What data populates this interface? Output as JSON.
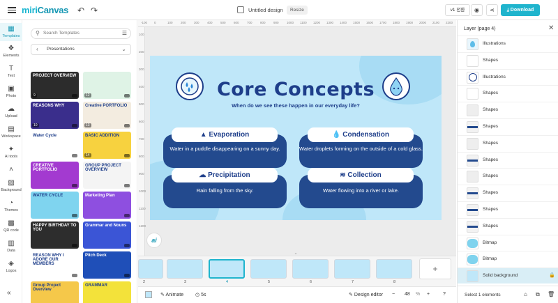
{
  "app": {
    "logo_a": "miri",
    "logo_b": "Canvas",
    "doc_title": "Untitled design",
    "resize": "Resize",
    "version": "v1 전환",
    "download": "Download"
  },
  "rail": [
    {
      "label": "Templates",
      "icon": "templates-icon"
    },
    {
      "label": "Elements",
      "icon": "elements-icon"
    },
    {
      "label": "Text",
      "icon": "text-icon"
    },
    {
      "label": "Photo",
      "icon": "photo-icon"
    },
    {
      "label": "Upload",
      "icon": "upload-icon"
    },
    {
      "label": "Workspace",
      "icon": "workspace-icon"
    },
    {
      "label": "AI tools",
      "icon": "ai-tools-icon"
    },
    {
      "label": "Background",
      "icon": "background-icon"
    },
    {
      "label": "Themes",
      "icon": "themes-icon"
    },
    {
      "label": "QR code",
      "icon": "qr-code-icon"
    },
    {
      "label": "Data",
      "icon": "data-icon"
    },
    {
      "label": "Logos",
      "icon": "logos-icon"
    }
  ],
  "templates": {
    "search_placeholder": "Search Templates",
    "category": "Presentations",
    "items": [
      {
        "title": "PROJECT OVERVIEW",
        "num": "9",
        "bg": "#2c2c2c"
      },
      {
        "title": "",
        "num": "12",
        "bg": "#dff3e6"
      },
      {
        "title": "REASONS WHY",
        "num": "10",
        "bg": "#3a2e8c"
      },
      {
        "title": "Creative PORTFOLIO",
        "num": "13",
        "bg": "#f3ece0"
      },
      {
        "title": "Water Cycle",
        "num": "",
        "bg": "#ffffff"
      },
      {
        "title": "BASIC ADDITION",
        "num": "14",
        "bg": "#f7d23f"
      },
      {
        "title": "CREATIVE PORTFOLIO",
        "num": "",
        "bg": "#a33ad0"
      },
      {
        "title": "GROUP PROJECT OVERVIEW",
        "num": "",
        "bg": "#f4f4f4"
      },
      {
        "title": "WATER CYCLE",
        "num": "",
        "bg": "#7fd4ef"
      },
      {
        "title": "Marketing Plan",
        "num": "",
        "bg": "#8e4fe0"
      },
      {
        "title": "HAPPY BIRTHDAY TO YOU",
        "num": "",
        "bg": "#2d2d2d"
      },
      {
        "title": "Grammar and Nouns",
        "num": "",
        "bg": "#3b55d6"
      },
      {
        "title": "REASON WHY I ADORE OUR MEMBERS",
        "num": "",
        "bg": "#ffffff"
      },
      {
        "title": "Pitch Deck",
        "num": "",
        "bg": "#1f4fb8"
      },
      {
        "title": "Group Project Overview",
        "num": "",
        "bg": "#f5c84a"
      },
      {
        "title": "GRAMMAR",
        "num": "",
        "bg": "#f3e23a"
      }
    ]
  },
  "slide": {
    "title": "Core Concepts",
    "subtitle": "When do we see these happen in our everyday life?",
    "cards": [
      {
        "head": "Evaporation",
        "body": "Water in a puddle disappearing on a sunny day."
      },
      {
        "head": "Condensation",
        "body": "Water droplets forming on the outside of a cold glass."
      },
      {
        "head": "Precipitation",
        "body": "Rain falling from the sky."
      },
      {
        "head": "Collection",
        "body": "Water flowing into a river or lake."
      }
    ]
  },
  "ruler_top": [
    "-100",
    "0",
    "100",
    "200",
    "300",
    "400",
    "500",
    "600",
    "700",
    "800",
    "900",
    "1000",
    "1100",
    "1200",
    "1300",
    "1400",
    "1500",
    "1600",
    "1700",
    "1800",
    "1900",
    "2000",
    "2100",
    "2200"
  ],
  "ruler_left": [
    "100",
    "200",
    "300",
    "400",
    "500",
    "600",
    "700",
    "800",
    "900",
    "1000",
    "1100",
    "1200"
  ],
  "pages": [
    "2",
    "3",
    "4",
    "5",
    "6",
    "7",
    "8"
  ],
  "bottom": {
    "animate": "Animate",
    "duration": "5s",
    "design_editor": "Design editor",
    "zoom": "48",
    "zoom_unit": "%"
  },
  "layers": {
    "title": "Layer (page 4)",
    "items": [
      {
        "label": "Illustrations",
        "sel": false
      },
      {
        "label": "Shapes",
        "sel": false
      },
      {
        "label": "Illustrations",
        "sel": false
      },
      {
        "label": "Shapes",
        "sel": false
      },
      {
        "label": "Shapes",
        "sel": false
      },
      {
        "label": "Shapes",
        "sel": false
      },
      {
        "label": "Shapes",
        "sel": false
      },
      {
        "label": "Shapes",
        "sel": false
      },
      {
        "label": "Shapes",
        "sel": false
      },
      {
        "label": "Shapes",
        "sel": false
      },
      {
        "label": "Shapes",
        "sel": false
      },
      {
        "label": "Shapes",
        "sel": false
      },
      {
        "label": "Bitmap",
        "sel": false
      },
      {
        "label": "Bitmap",
        "sel": false
      },
      {
        "label": "Solid background",
        "sel": true
      }
    ],
    "select_label": "Select 1 elements"
  }
}
